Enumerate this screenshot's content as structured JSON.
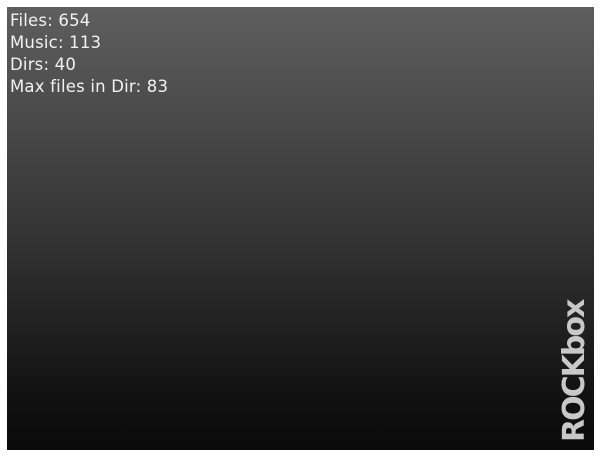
{
  "stats": {
    "files": "Files: 654",
    "music": "Music: 113",
    "dirs": "Dirs: 40",
    "max_files_in_dir": "Max files in Dir: 83"
  },
  "logo": {
    "text": "ROCKbox",
    "color": "#c8c8c8"
  },
  "colors": {
    "background_top": "#5e5e5e",
    "background_bottom": "#0a0a0a",
    "text": "#f2f2f2"
  }
}
